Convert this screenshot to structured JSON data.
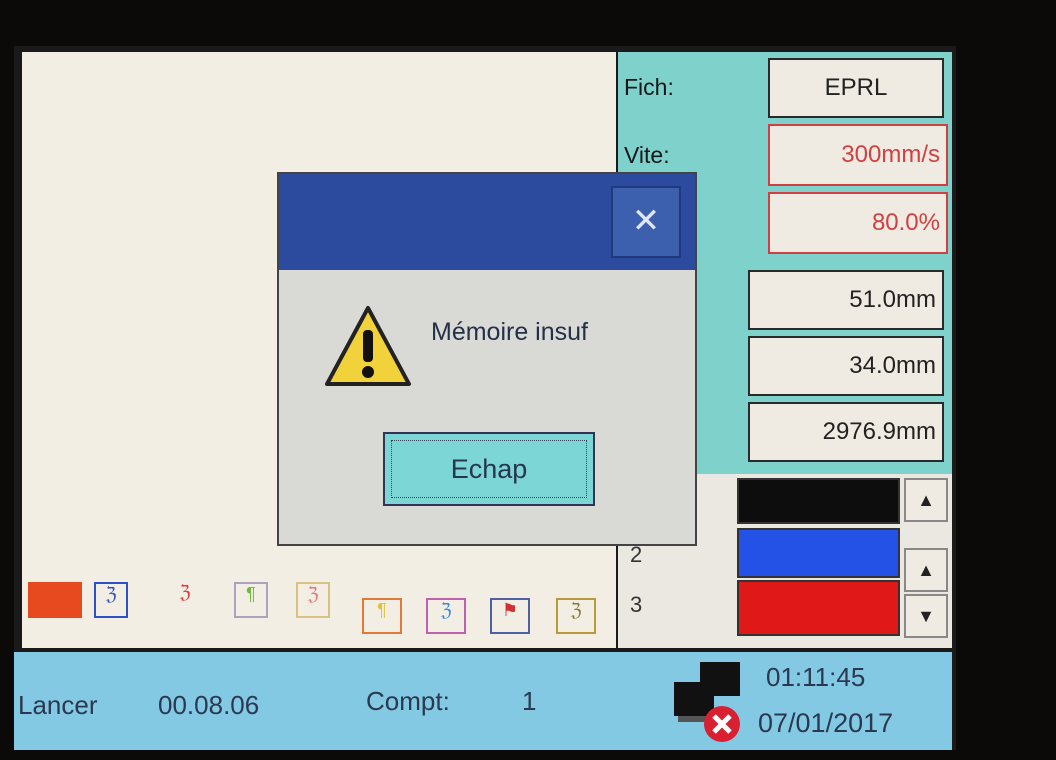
{
  "panel": {
    "fich_label": "Fich:",
    "fich_value": "EPRL",
    "vite_label": "Vite:",
    "vite_value": "300mm/s",
    "power_value": "80.0%",
    "width_value": "51.0mm",
    "height_value": "34.0mm",
    "length_value": "2976.9mm"
  },
  "layers": {
    "rows": [
      "2",
      "3"
    ],
    "colors": [
      "#0d0d0d",
      "#2452e6",
      "#e01818"
    ]
  },
  "dialog": {
    "message": "Mémoire insuf",
    "button_label": "Echap",
    "close_glyph": "✕",
    "icon": "warning-icon"
  },
  "status": {
    "run_label": "Lancer",
    "run_time": "00.08.06",
    "count_label": "Compt:",
    "count_value": "1",
    "time": "01:11:45",
    "date": "07/01/2017",
    "icon": "network-disconnected-icon"
  },
  "toolbar": {
    "tool_colors": [
      "#e64a1e",
      "#3050c8",
      "#e03a40",
      "#6fb83a",
      "#e07a7a",
      "#e0c23a",
      "#3a8ae0",
      "#d03030",
      "#b79a3a"
    ]
  }
}
